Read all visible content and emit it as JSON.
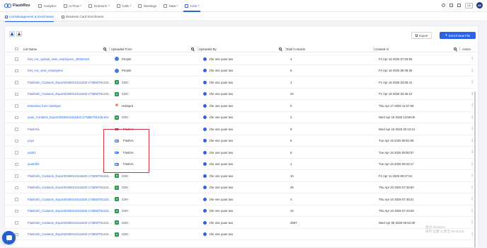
{
  "app": {
    "name": "FlashRev"
  },
  "nav": [
    {
      "label": "Analytics",
      "icon": "chart-icon",
      "dropdown": false
    },
    {
      "label": "AI Flow",
      "icon": "flow-icon",
      "dropdown": true
    },
    {
      "label": "Outreach",
      "icon": "send-icon",
      "dropdown": true
    },
    {
      "label": "Calls",
      "icon": "phone-icon",
      "dropdown": true
    },
    {
      "label": "Meetings",
      "icon": "calendar-icon",
      "dropdown": false
    },
    {
      "label": "Data",
      "icon": "database-icon",
      "dropdown": true
    },
    {
      "label": "Lists",
      "icon": "list-icon",
      "dropdown": true,
      "active": true
    }
  ],
  "topright": {
    "lang": "US",
    "avatar": "AD"
  },
  "tabs": [
    {
      "label": "List Management & Enrichment",
      "active": true
    },
    {
      "label": "Business Card Enrichment",
      "active": false
    }
  ],
  "toolbar": {
    "export_label": "Export",
    "enrich_label": "Enrich New File"
  },
  "columns": {
    "name": "List Name",
    "source": "Uploaded From",
    "by": "Uploaded By",
    "total": "Total Contacts",
    "created": "Created At",
    "action": "Action"
  },
  "rows": [
    {
      "name": "test_csv_upload_view_employees_20250418",
      "source": "People",
      "source_icon": "people",
      "by": "zhe one yuan two",
      "total": "4",
      "created": "Fri Apr 18 2025 07:03:50"
    },
    {
      "name": "test_csv_view_employees",
      "source": "People",
      "source_icon": "people",
      "by": "zhe one yuan two",
      "total": "5",
      "created": "Fri Apr 18 2025 06:49:35"
    },
    {
      "name": "FlashInfo_Contacts_Export20250110111832-173650791215...",
      "source": "CSV",
      "source_icon": "csv",
      "by": "zhe one yuan two",
      "total": "1",
      "created": "Fri Apr 18 2025 03:08:41"
    },
    {
      "name": "FlashInfo_Contacts_Export20250110111832-173650791215...",
      "source": "CSV",
      "source_icon": "csv",
      "by": "zhe one yuan two",
      "total": "10",
      "created": "Fri Apr 18 2025 02:45:12"
    },
    {
      "name": "Extension from HubSpot",
      "source": "Hubspot",
      "source_icon": "hubspot",
      "by": "zhe one yuan two",
      "total": "0",
      "created": "Thu Apr 17 2025 11:57:59"
    },
    {
      "name": "yuan_Contacts_Export20250110111832-173650791215.xlsx",
      "source": "CSV",
      "source_icon": "csv",
      "by": "zhe one yuan two",
      "total": "2",
      "created": "Wed Apr 16 2025 13:58:06"
    },
    {
      "name": "FlashAI1",
      "source": "FlashAI",
      "source_icon": "flash",
      "by": "zhe one yuan two",
      "total": "9",
      "created": "Wed Apr 16 2025 20:13:44"
    },
    {
      "name": "yuyu",
      "source": "FlashAI",
      "source_icon": "flash",
      "by": "zhe one yuan two",
      "total": "6",
      "created": "Tue Apr 15 2025 08:51:09"
    },
    {
      "name": "yu001",
      "source": "FlashAI",
      "source_icon": "flash",
      "by": "zhe one yuan two",
      "total": "8",
      "created": "Tue Apr 15 2025 08:50:07"
    },
    {
      "name": "yuan002",
      "source": "FlashAI",
      "source_icon": "flash",
      "by": "zhe one yuan two",
      "total": "1",
      "created": "Tue Apr 15 2025 08:42:17"
    },
    {
      "name": "FlashInfo_Contacts_Export20250110111832-173650791215...",
      "source": "CSV",
      "source_icon": "csv",
      "by": "zhe one yuan two",
      "total": "10",
      "created": "Fri Apr 11 2025 08:27:54"
    },
    {
      "name": "FlashInfo_Contacts_Export20250110111832-173650791215...",
      "source": "CSV",
      "source_icon": "csv",
      "by": "zhe one yuan two",
      "total": "45",
      "created": "Thu Apr 10 2025 07:35:50"
    },
    {
      "name": "FlashInfo_Contacts_Export20250110111832-173650791215...",
      "source": "CSV",
      "source_icon": "csv",
      "by": "zhe one yuan two",
      "total": "3",
      "created": "Thu Apr 10 2025 07:38:21"
    },
    {
      "name": "FlashInfo_Contacts_Export20250110111832-173650791215...",
      "source": "CSV",
      "source_icon": "csv",
      "by": "zhe one yuan two",
      "total": "10",
      "created": "Thu Apr 10 2025 07:23:29"
    },
    {
      "name": "FlashInfo_Contacts_Export20250110111832-173650791215...",
      "source": "CSV",
      "source_icon": "csv",
      "by": "zhe one yuan two",
      "total": "4587",
      "created": "Wed Apr 09 2025 06:54:39"
    },
    {
      "name": "FlashInfo_Contacts_Export20250110111832-173650791215...",
      "source": "CSV",
      "source_icon": "csv",
      "by": "zhe one yuan two",
      "total": "",
      "created": ""
    }
  ],
  "row_action_glyph": "⋮",
  "watermark": {
    "line1": "激活 Windows",
    "line2": "转到\"设置\"以激活 Windows。"
  },
  "colors": {
    "accent": "#2b63e6",
    "highlight_border": "#d6323a",
    "csv": "#2e9d54",
    "hubspot": "#ff7a3d"
  }
}
